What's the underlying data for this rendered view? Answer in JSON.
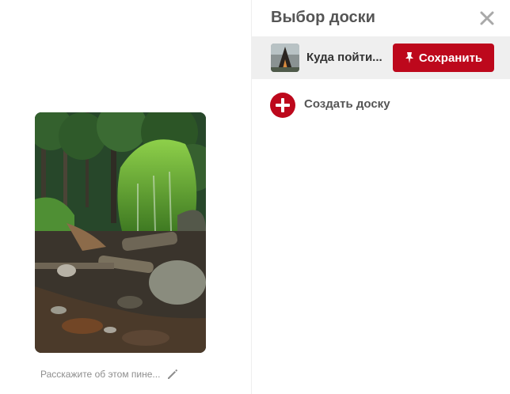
{
  "dialog": {
    "title": "Выбор доски",
    "close_icon": "close-icon"
  },
  "preview": {
    "description_placeholder": "Расскажите об этом пине...",
    "edit_icon": "pencil-icon"
  },
  "boards": [
    {
      "name": "Куда пойти...",
      "save_label": "Сохранить",
      "save_icon": "pushpin-icon"
    }
  ],
  "create_board": {
    "label": "Создать доску",
    "icon": "plus-circle-icon"
  },
  "colors": {
    "brand_red": "#bd081c",
    "row_highlight": "#efefef",
    "title_text": "#555555",
    "muted_text": "#8e8e8e"
  }
}
